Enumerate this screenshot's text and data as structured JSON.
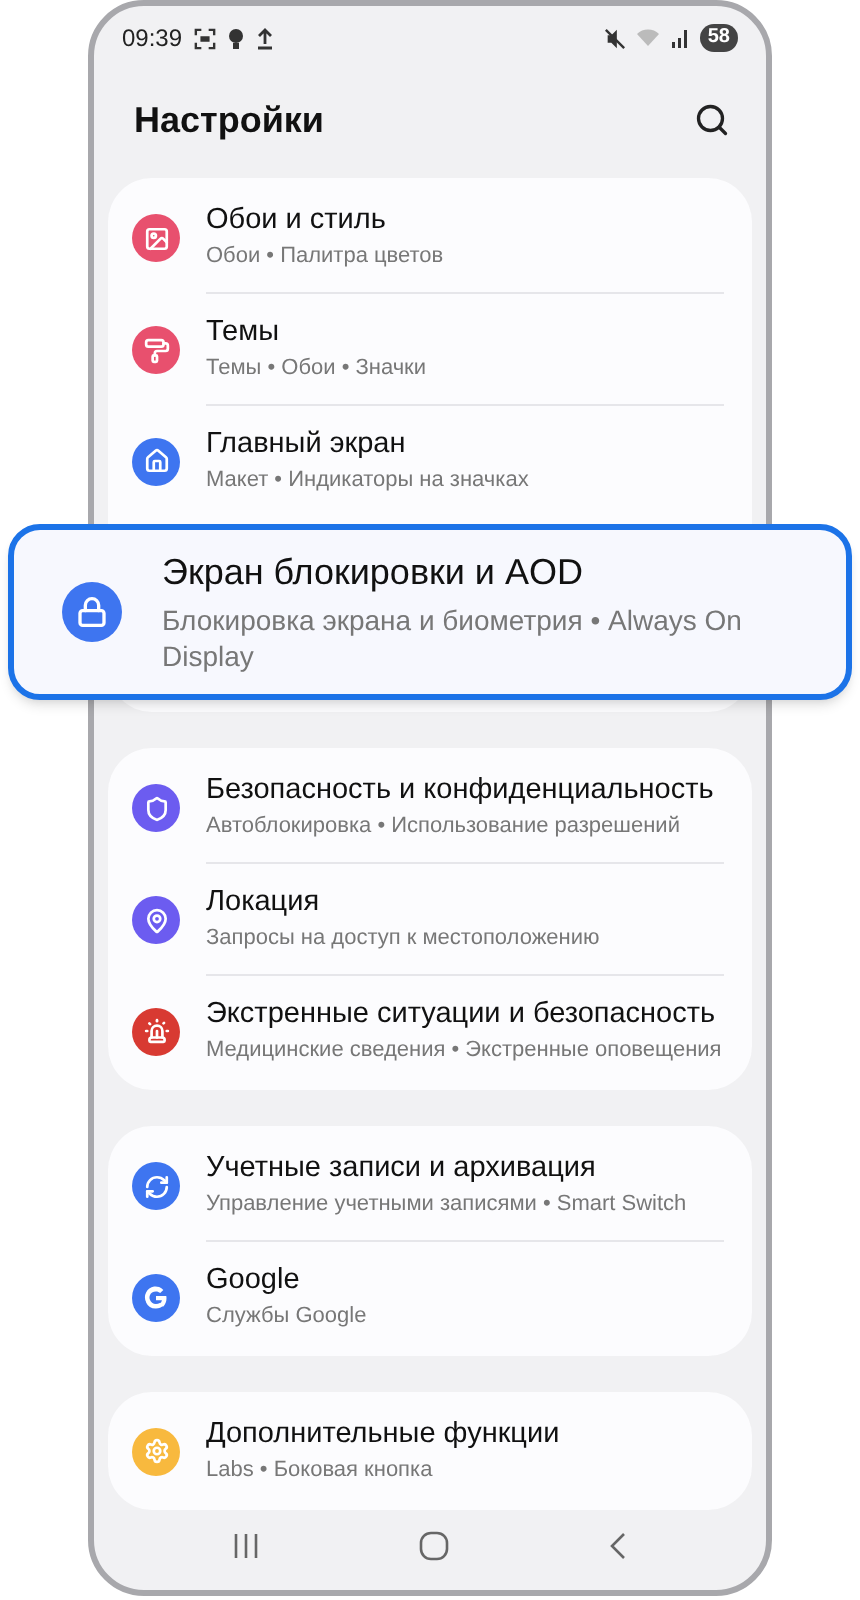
{
  "status_bar": {
    "time": "09:39",
    "battery": "58"
  },
  "header": {
    "title": "Настройки"
  },
  "groups": [
    {
      "items": [
        {
          "title": "Обои и стиль",
          "subtitle": "Обои • Палитра цветов",
          "color": "#e8506e",
          "highlighted": false
        },
        {
          "title": "Темы",
          "subtitle": "Темы • Обои • Значки",
          "color": "#e8506e",
          "highlighted": false
        },
        {
          "title": "Главный экран",
          "subtitle": "Макет • Индикаторы на значках",
          "color": "#3e75f0",
          "highlighted": false
        },
        {
          "title": "Экран блокировки и AOD",
          "subtitle": "Блокировка экрана и биометрия • Always On Display",
          "color": "#3e75f0",
          "highlighted": true
        }
      ]
    },
    {
      "items": [
        {
          "title": "Безопасность и конфиденциальность",
          "subtitle": "Автоблокировка • Использование разрешений",
          "color": "#6c5cf0",
          "highlighted": false
        },
        {
          "title": "Локация",
          "subtitle": "Запросы на доступ к местоположению",
          "color": "#6c5cf0",
          "highlighted": false
        },
        {
          "title": "Экстренные ситуации и безопасность",
          "subtitle": "Медицинские сведения • Экстренные оповещения",
          "color": "#d83a32",
          "highlighted": false
        }
      ]
    },
    {
      "items": [
        {
          "title": "Учетные записи и архивация",
          "subtitle": "Управление учетными записями • Smart Switch",
          "color": "#3e75f0",
          "highlighted": false
        },
        {
          "title": "Google",
          "subtitle": "Службы Google",
          "color": "#3e75f0",
          "highlighted": false
        }
      ]
    },
    {
      "items": [
        {
          "title": "Дополнительные функции",
          "subtitle": "Labs • Боковая кнопка",
          "color": "#f8b93e",
          "highlighted": false
        }
      ]
    }
  ]
}
